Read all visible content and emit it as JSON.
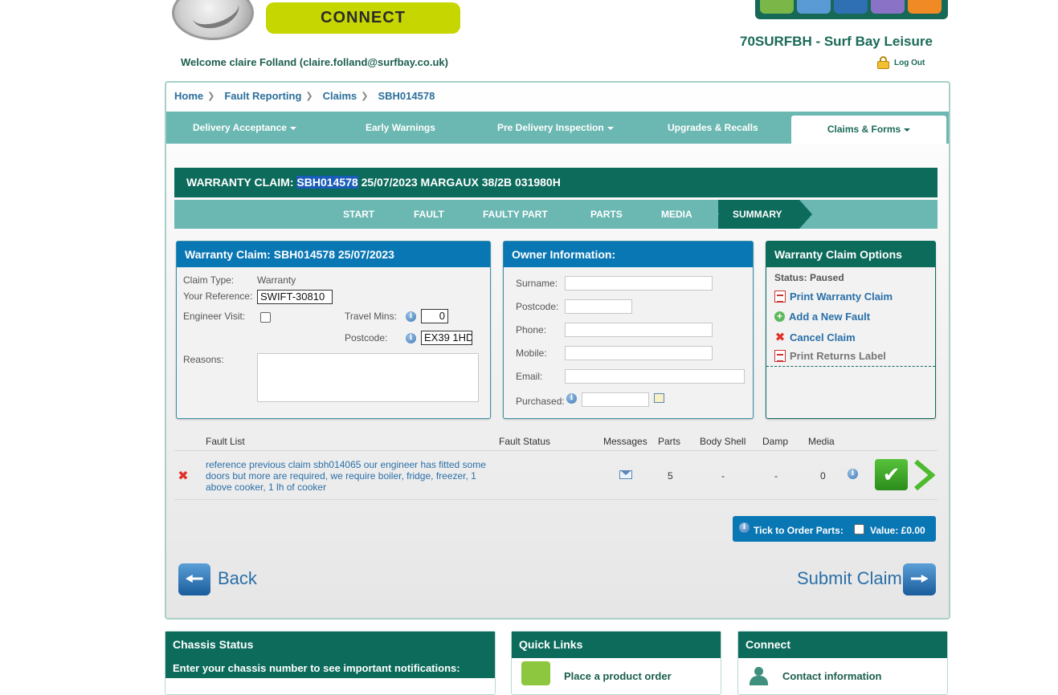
{
  "header": {
    "connect_label": "CONNECT",
    "welcome": "Welcome claire Folland (claire.folland@surfbay.co.uk)",
    "dealer": "70SURFBH - Surf Bay Leisure",
    "logout": "Log Out",
    "tray_colors": [
      "#7ab648",
      "#5b9bd5",
      "#2f6fb3",
      "#8a73c7",
      "#f08a24"
    ]
  },
  "breadcrumb": [
    "Home",
    "Fault Reporting",
    "Claims",
    "SBH014578"
  ],
  "nav": {
    "items": [
      "Delivery Acceptance",
      "Early Warnings",
      "Pre Delivery Inspection",
      "Upgrades & Recalls",
      "Claims & Forms"
    ],
    "active": "Claims & Forms"
  },
  "claim_header": {
    "prefix": "WARRANTY CLAIM: ",
    "ref": "SBH014578",
    "rest": " 25/07/2023 MARGAUX 38/2B 031980H"
  },
  "steps": [
    "START",
    "FAULT",
    "FAULTY PART",
    "PARTS",
    "MEDIA",
    "SUMMARY"
  ],
  "claim_box": {
    "title": "Warranty Claim: SBH014578 25/07/2023",
    "claim_type_label": "Claim Type:",
    "claim_type": "Warranty",
    "your_ref_label": "Your Reference:",
    "your_ref": "SWIFT-30810",
    "engineer_label": "Engineer Visit:",
    "travel_label": "Travel Mins:",
    "travel_value": "0",
    "postcode_label": "Postcode:",
    "postcode_value": "EX39 1HD",
    "reasons_label": "Reasons:"
  },
  "owner_box": {
    "title": "Owner Information:",
    "surname": "Surname:",
    "postcode": "Postcode:",
    "phone": "Phone:",
    "mobile": "Mobile:",
    "email": "Email:",
    "purchased": "Purchased:"
  },
  "options_box": {
    "title": "Warranty Claim Options",
    "status": "Status: Paused",
    "print": "Print Warranty Claim",
    "add_fault": "Add a New Fault",
    "cancel": "Cancel Claim",
    "returns": "Print Returns Label"
  },
  "fault_table": {
    "headers": [
      "Fault List",
      "Fault Status",
      "Messages",
      "Parts",
      "Body Shell",
      "Damp",
      "Media"
    ],
    "row": {
      "description": "reference previous claim sbh014065 our engineer has fitted some doors but more are required, we require boiler, fridge, freezer, 1 above cooker, 1 lh of cooker",
      "status": "",
      "parts": "5",
      "body_shell": "-",
      "damp": "-",
      "media": "0"
    }
  },
  "order": {
    "label": "Tick to Order Parts:",
    "value": "Value: £0.00"
  },
  "actions": {
    "back": "Back",
    "submit": "Submit Claim"
  },
  "bottom": {
    "chassis_title": "Chassis Status",
    "chassis_text": "Enter your chassis number to see important notifications:",
    "quick_title": "Quick Links",
    "quick_item": "Place a product order",
    "connect_title": "Connect",
    "connect_item": "Contact information"
  }
}
